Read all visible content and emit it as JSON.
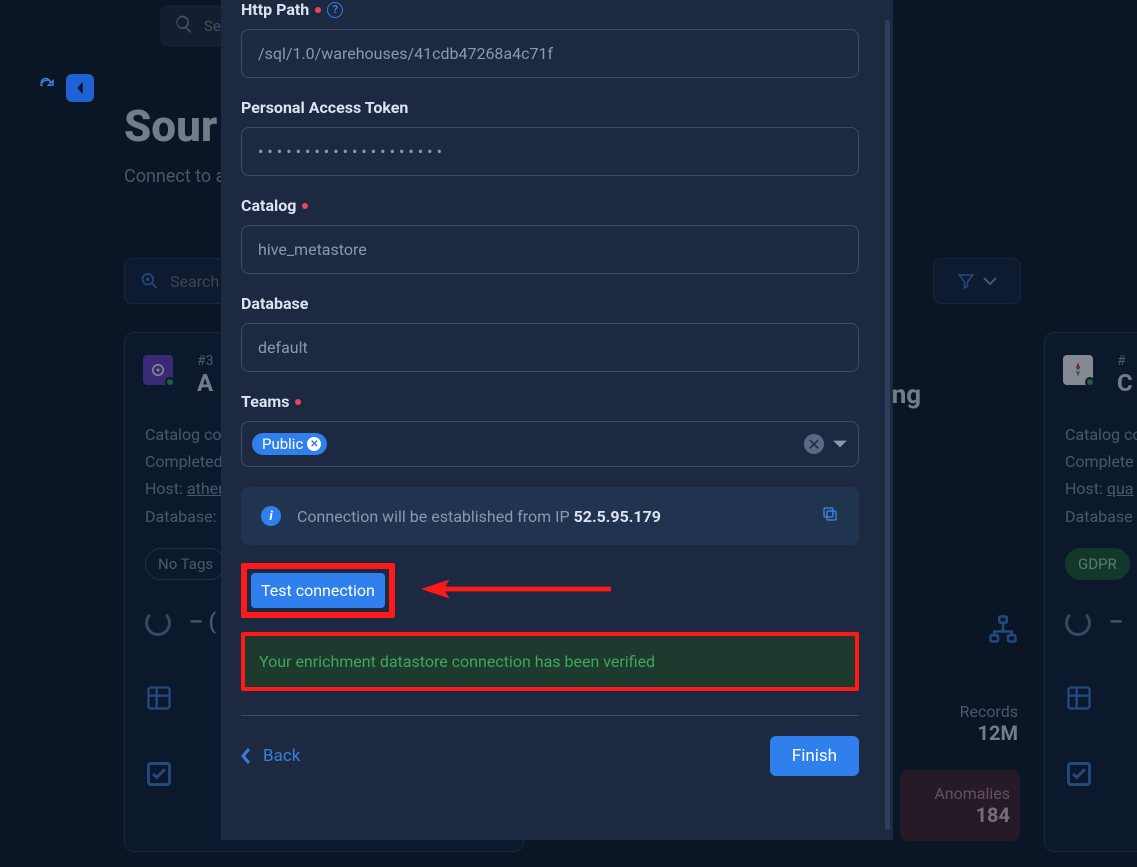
{
  "top_search_placeholder": "Sea",
  "page_title": "Sour",
  "page_subtitle": "Connect to a",
  "sec_search_placeholder": "Search",
  "staging_fragment": "ging",
  "card_left": {
    "hash": "#3",
    "title": "A",
    "l1": "Catalog co",
    "l2": "Completed",
    "l3a": "Host:",
    "l3b": "ather",
    "l4": "Database:",
    "tag": "No Tags"
  },
  "card_right": {
    "hash": "#",
    "title": "C",
    "l1": "Catalog co",
    "l2": "Complete",
    "l3a": "Host:",
    "l3b": "qua",
    "l4": "Database",
    "tag": "GDPR"
  },
  "right_stats": {
    "records_label": "Records",
    "records": "12M"
  },
  "right_anom": {
    "label": "Anomalies",
    "val": "184"
  },
  "form": {
    "http_path_label": "Http Path",
    "http_path_value": "/sql/1.0/warehouses/41cdb47268a4c71f",
    "pat_label": "Personal Access Token",
    "pat_value": "••••••••••••••••••••",
    "catalog_label": "Catalog",
    "catalog_value": "hive_metastore",
    "database_label": "Database",
    "database_value": "default",
    "teams_label": "Teams",
    "team_chip": "Public",
    "info_prefix": "Connection will be established from IP ",
    "info_ip": "52.5.95.179",
    "test_btn": "Test connection",
    "success": "Your enrichment datastore connection has been verified",
    "back_label": "Back",
    "finish_label": "Finish"
  }
}
